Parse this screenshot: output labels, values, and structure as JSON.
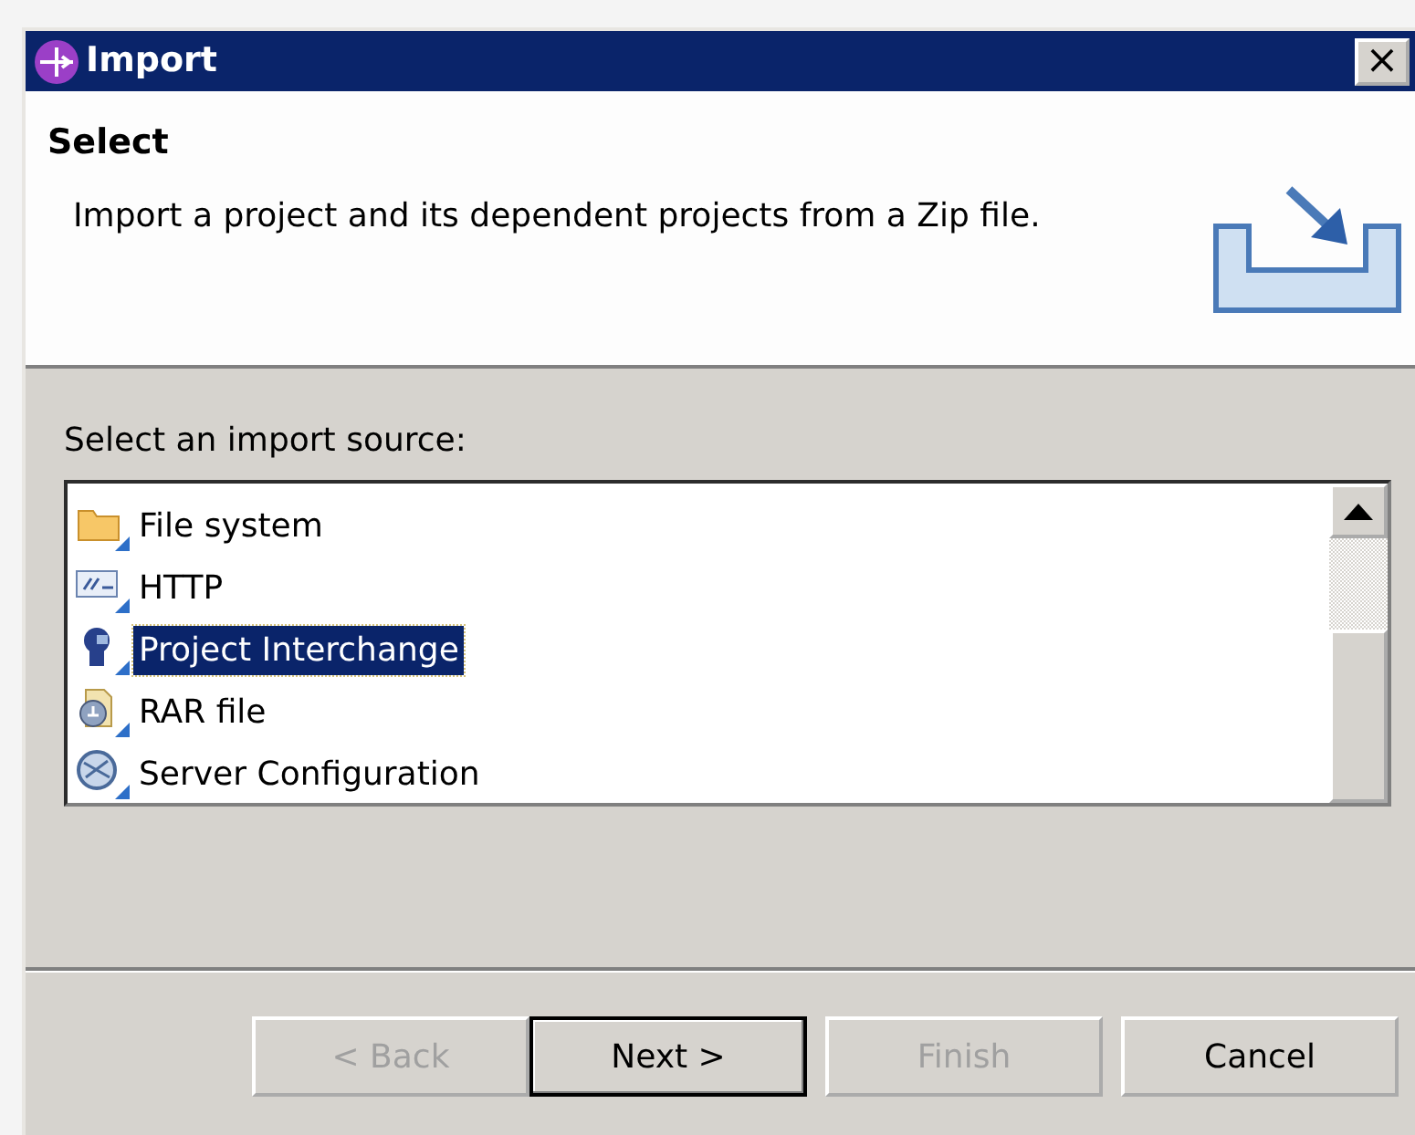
{
  "window": {
    "title": "Import",
    "close": "×"
  },
  "header": {
    "title": "Select",
    "description": "Import a project and its dependent projects from a Zip file."
  },
  "source_list": {
    "label": "Select an import source:",
    "items": [
      {
        "label": "File system",
        "kind": "folder",
        "selected": false
      },
      {
        "label": "HTTP",
        "kind": "http",
        "selected": false
      },
      {
        "label": "Project Interchange",
        "kind": "interchange",
        "selected": true
      },
      {
        "label": "RAR file",
        "kind": "rar",
        "selected": false
      },
      {
        "label": "Server Configuration",
        "kind": "server",
        "selected": false
      }
    ]
  },
  "buttons": [
    {
      "label": "< Back",
      "disabled": true,
      "default": false
    },
    {
      "label": "Next >",
      "disabled": false,
      "default": true
    },
    {
      "label": "Finish",
      "disabled": true,
      "default": false
    },
    {
      "label": "Cancel",
      "disabled": false,
      "default": false
    }
  ]
}
